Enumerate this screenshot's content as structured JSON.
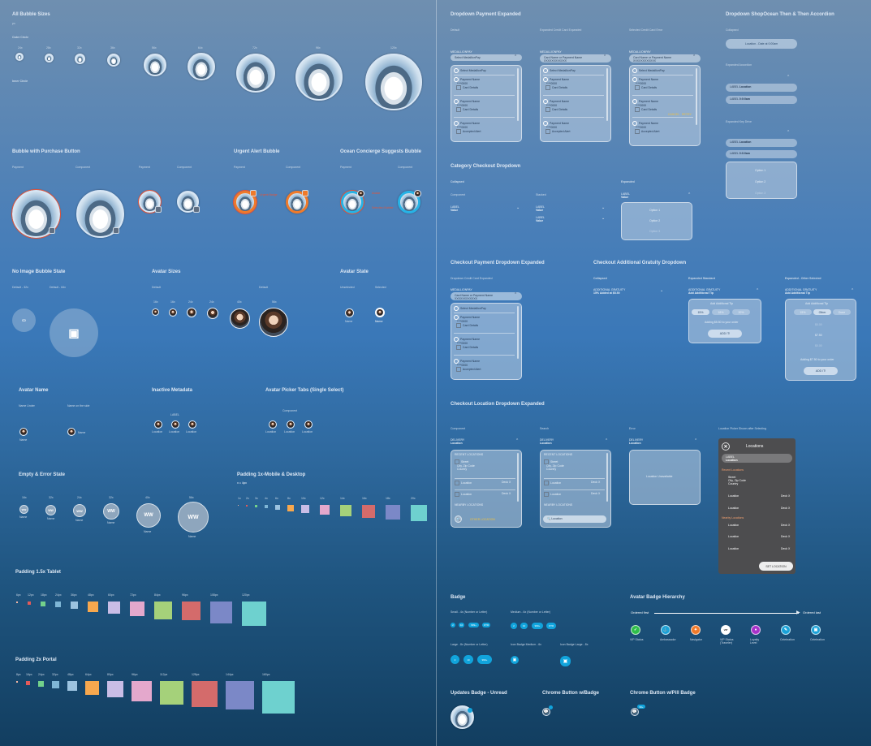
{
  "left": {
    "all_bubble_sizes": {
      "title": "All Bubble Sizes",
      "sub": "px",
      "outer_label": "Outer Circle",
      "inner_label": "Inner Circle",
      "bubble_size_labels": [
        "24x",
        "28x",
        "32x",
        "36x",
        "56x",
        "64x",
        "72x",
        "96x",
        "120x"
      ]
    },
    "purchase": {
      "title": "Bubble with Purchase Button",
      "labels": [
        "Payment",
        "Component",
        "Payment",
        "Component"
      ]
    },
    "urgent": {
      "title": "Urgent Alert Bubble",
      "labels": [
        "Payment",
        "Component"
      ],
      "note": "Urgent Badge"
    },
    "concierge": {
      "title": "Ocean Concierge Suggests Bubble",
      "labels": [
        "Payment",
        "Component"
      ],
      "note1": "Avatar",
      "note2": "Selection Bubble"
    },
    "no_image": {
      "title": "No Image Bubble State",
      "labels": [
        "Default - 32x",
        "Default - 64x"
      ]
    },
    "avatar_sizes": {
      "title": "Avatar Sizes",
      "labels": [
        "Default",
        "Default"
      ],
      "size_labels": [
        "16x",
        "16x",
        "24x",
        "24x",
        "40x",
        "56x"
      ]
    },
    "avatar_state": {
      "title": "Avatar State",
      "labels": [
        "Unselected",
        "Selected"
      ],
      "names": [
        "Name",
        "Name"
      ]
    },
    "avatar_name": {
      "title": "Avatar Name",
      "labels": [
        "Name Under",
        "Name on the side"
      ],
      "names": [
        "Name",
        "Name"
      ]
    },
    "inactive_metadata": {
      "title": "Inactive Metadata",
      "label": "LABEL",
      "names": [
        "Location",
        "Location",
        "Location"
      ]
    },
    "avatar_picker": {
      "title": "Avatar Picker Tabs (Single Select)",
      "label": "Component",
      "names": [
        "Location",
        "Location",
        "Location"
      ]
    },
    "empty_error": {
      "title": "Empty & Error State",
      "sizes": [
        "16x",
        "32x",
        "24x",
        "32x",
        "40x",
        "56x"
      ],
      "initials": "WW",
      "names": [
        "Name",
        "Name",
        "Name",
        "Name",
        "Name",
        "Name"
      ]
    },
    "padding_mobile": {
      "title": "Padding 1x-Mobile & Desktop",
      "sub": "x = 4px",
      "labels": [
        "1x",
        "2x",
        "3x",
        "4x",
        "6x",
        "8x",
        "10x",
        "12x",
        "14x",
        "16x",
        "18x",
        "20x"
      ],
      "colors": [
        "#f2b7a5",
        "#e35a5a",
        "#73d18b",
        "#7fb6d6",
        "#9cc3e0",
        "#f7a84e",
        "#c9bde6",
        "#e4a8cc",
        "#a5d17a",
        "#d46b6b",
        "#7b88c7",
        "#6ed1cf"
      ]
    },
    "padding_tablet": {
      "title": "Padding 1.5x Tablet",
      "labels": [
        "6px",
        "12px",
        "18px",
        "24px",
        "36px",
        "48px",
        "60px",
        "72px",
        "84px",
        "96px",
        "108px",
        "120px"
      ]
    },
    "padding_portal": {
      "title": "Padding 2x Portal",
      "labels": [
        "8px",
        "16px",
        "24px",
        "32px",
        "48px",
        "64px",
        "80px",
        "96px",
        "112px",
        "128px",
        "144px",
        "160px"
      ]
    }
  },
  "right": {
    "payment_expanded": {
      "title": "Dropdown Payment Expanded",
      "cols": [
        "Default",
        "Expanded Credit Card Expanded",
        "Selected Credit Card Error"
      ],
      "label": "MEDALLIONPAY",
      "value_default": "Select MedallionPay",
      "value_card": "Card Name or Payment Name",
      "masked": "XXXXXXXXXXXX",
      "options": [
        "Select MedallionPay",
        "Payment Name",
        "Payment Name",
        "Payment Name"
      ],
      "sub": [
        "****0000",
        "Card Details",
        "Card Details",
        "Accepted Alert"
      ],
      "error": "Card Error",
      "actions": [
        "CANCEL",
        "RETRY"
      ]
    },
    "shopocean": {
      "title": "Dropdown ShopOcean Then & Then Accordion",
      "collapsed": "Collapsed",
      "pill": "Location - Date at 0:00am",
      "expanded": "Expanded Accordion",
      "labels": [
        "LABEL",
        "LABEL"
      ],
      "values": [
        "Location",
        "0:0:0am"
      ],
      "exp2": "Expanded Key Drive",
      "opts": [
        "Option 1",
        "Option 2",
        "Option 3"
      ]
    },
    "category": {
      "title": "Category Checkout Dropdown",
      "collapsed": "Collapsed",
      "expanded": "Expanded",
      "cols": [
        "Component",
        "Stacked"
      ],
      "label": "LABEL",
      "value": "Value",
      "options": [
        "Option 1",
        "Option 2",
        "Option 3"
      ]
    },
    "checkout_payment": {
      "title": "Checkout Payment Dropdown Expanded",
      "sub": "Dropdown Credit Card Expanded"
    },
    "gratuity": {
      "title": "Checkout Additional Gratuity Dropdown",
      "cols": [
        "Collapsed",
        "Expanded Standard",
        "Expanded - Other Selected"
      ],
      "label": "ADDITIONAL GRATUITY",
      "value": "15% Added at $5.50",
      "value2": "Add Additional Tip",
      "tips": [
        "15%",
        "18%",
        "20%"
      ],
      "tips2": [
        "15%",
        "Other",
        "Done"
      ],
      "line": "Adding $5.50 to your order",
      "line2": "Adding $7.50 to your order",
      "btn": "ADD IT!",
      "amounts": [
        "$0.00",
        "$7.50",
        "$0.00"
      ]
    },
    "location": {
      "title": "Checkout Location Dropdown Expanded",
      "cols": [
        "Component",
        "Search",
        "Error",
        "Location Picker Shown after Selecting"
      ],
      "label": "DELIVERY",
      "value": "Location",
      "recent": "RECENT LOCATIONS",
      "nearby": "NEARBY LOCATIONS",
      "addr": [
        "Street",
        "City, Zip Code",
        "Country"
      ],
      "loc": "Location",
      "deck": "Deck X",
      "other": "OTHER LOCATION",
      "search": "Location",
      "unavail": "Location Unavailable",
      "modal": {
        "title": "Locations",
        "label": "LABEL",
        "value": "Location",
        "recent": "Recent Locations",
        "nearby": "Nearby Locations",
        "btn": "SET LOCATION"
      }
    },
    "badge": {
      "title": "Badge",
      "rows": [
        "Small - 4x (Number or Letter)",
        "Medium - 6x (Number or Letter)",
        "Large - 8x (Number or Letter)",
        "Icon Badge Medium - 6x",
        "Icon Badge Large - 8x"
      ],
      "small": [
        "2",
        "10",
        "999+",
        "OTR"
      ],
      "medium": [
        "2",
        "10",
        "999+",
        "OTR"
      ],
      "large": [
        "2",
        "10",
        "999+"
      ]
    },
    "hierarchy": {
      "title": "Avatar Badge Hierarchy",
      "first": "Ordered first",
      "last": "Ordered last",
      "items": [
        {
          "name": "VIP Status",
          "color": "#2fbf4a"
        },
        {
          "name": "Ambassador",
          "color": "#1aa2d8"
        },
        {
          "name": "Navigator",
          "color": "#f07a2a"
        },
        {
          "name": "VIP Status (Traveler)",
          "color": "#ffffff"
        },
        {
          "name": "Loyalty Level",
          "color": "#a832c9"
        },
        {
          "name": "Celebration",
          "color": "#1aa2d8"
        },
        {
          "name": "Celebration",
          "color": "#1aa2d8"
        }
      ]
    },
    "updates": {
      "title": "Updates Badge - Unread"
    },
    "chrome": {
      "title": "Chrome Button w/Badge"
    },
    "chrome_pill": {
      "title": "Chrome Button w/Pill Badge",
      "badge": "99+"
    }
  }
}
